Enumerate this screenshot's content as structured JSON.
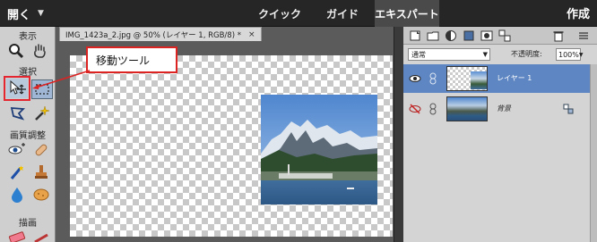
{
  "topbar": {
    "open_label": "開く",
    "tabs": [
      {
        "label": "クイック"
      },
      {
        "label": "ガイド"
      },
      {
        "label": "エキスパート"
      }
    ],
    "create_label": "作成"
  },
  "toolbox": {
    "sections": {
      "view": "表示",
      "select": "選択",
      "enhance": "画質調整",
      "draw": "描画"
    },
    "tools": {
      "zoom": "zoom-icon",
      "hand": "hand-icon",
      "move": "move-icon",
      "marquee": "marquee-icon",
      "lasso": "lasso-icon",
      "magic_wand": "magic-wand-icon",
      "red_eye": "red-eye-icon",
      "healing": "healing-brush-icon",
      "smart_brush": "smart-brush-icon",
      "clone_stamp": "clone-stamp-icon",
      "blur": "blur-icon",
      "sponge": "sponge-icon",
      "eraser": "eraser-icon",
      "brush": "brush-icon"
    }
  },
  "document": {
    "tab_title": "IMG_1423a_2.jpg @ 50% (レイヤー 1, RGB/8) *",
    "close_glyph": "×"
  },
  "callout": {
    "text": "移動ツール",
    "color": "#d22222"
  },
  "layers_panel": {
    "blend_mode": "通常",
    "opacity_label": "不透明度:",
    "opacity_value": "100%",
    "layers": [
      {
        "name": "レイヤー 1",
        "visible": true,
        "selected": true
      },
      {
        "name": "背景",
        "visible": false,
        "selected": false,
        "locked": true
      }
    ]
  },
  "colors": {
    "accent": "#5d86c2",
    "selection_outline": "#e3262f"
  }
}
